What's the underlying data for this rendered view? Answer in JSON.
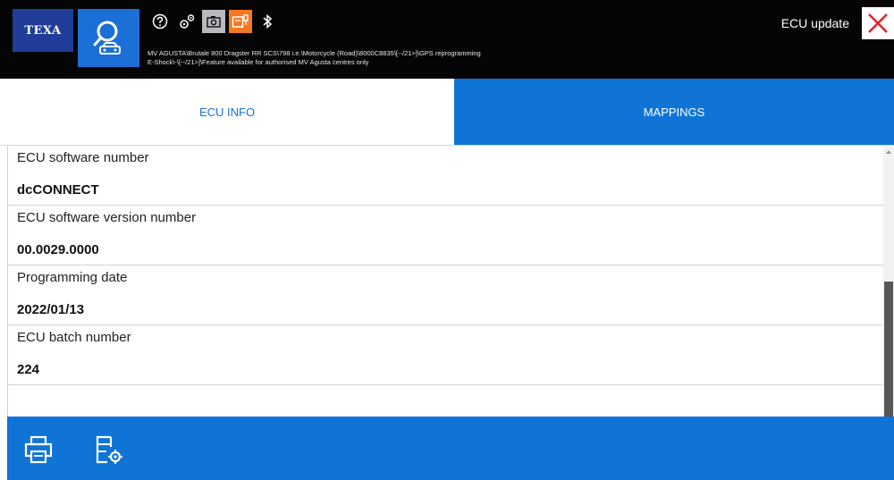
{
  "header": {
    "brand": "TEXA",
    "path_line1": "MV AGUSTA\\Brutale 800 Dragster RR SCS\\798 i.e.\\Motorcycle (Road)\\8000C8835\\[--/21>]\\GPS reprogramming",
    "path_line2": "E-Shock\\-\\[--/21>]\\Feature available for authorised MV Agusta centres only",
    "page_title": "ECU update",
    "icons": [
      "search-car-icon",
      "help-icon",
      "settings-icon",
      "camera-icon",
      "connection-icon",
      "bluetooth-icon",
      "close-icon"
    ]
  },
  "tabs": [
    {
      "label": "ECU INFO",
      "active": false
    },
    {
      "label": "MAPPINGS",
      "active": true
    }
  ],
  "ecu_info": [
    {
      "label": "ECU software number",
      "value": "dcCONNECT"
    },
    {
      "label": "ECU software version number",
      "value": "00.0029.0000"
    },
    {
      "label": "Programming date",
      "value": "2022/01/13"
    },
    {
      "label": "ECU batch number",
      "value": "224"
    }
  ],
  "footer": {
    "icons": [
      "print-icon",
      "report-settings-icon"
    ]
  },
  "colors": {
    "accent_blue": "#0f74d6",
    "brand_blue": "#213d99",
    "close_red": "#e8202a",
    "connection_orange": "#f47921"
  }
}
